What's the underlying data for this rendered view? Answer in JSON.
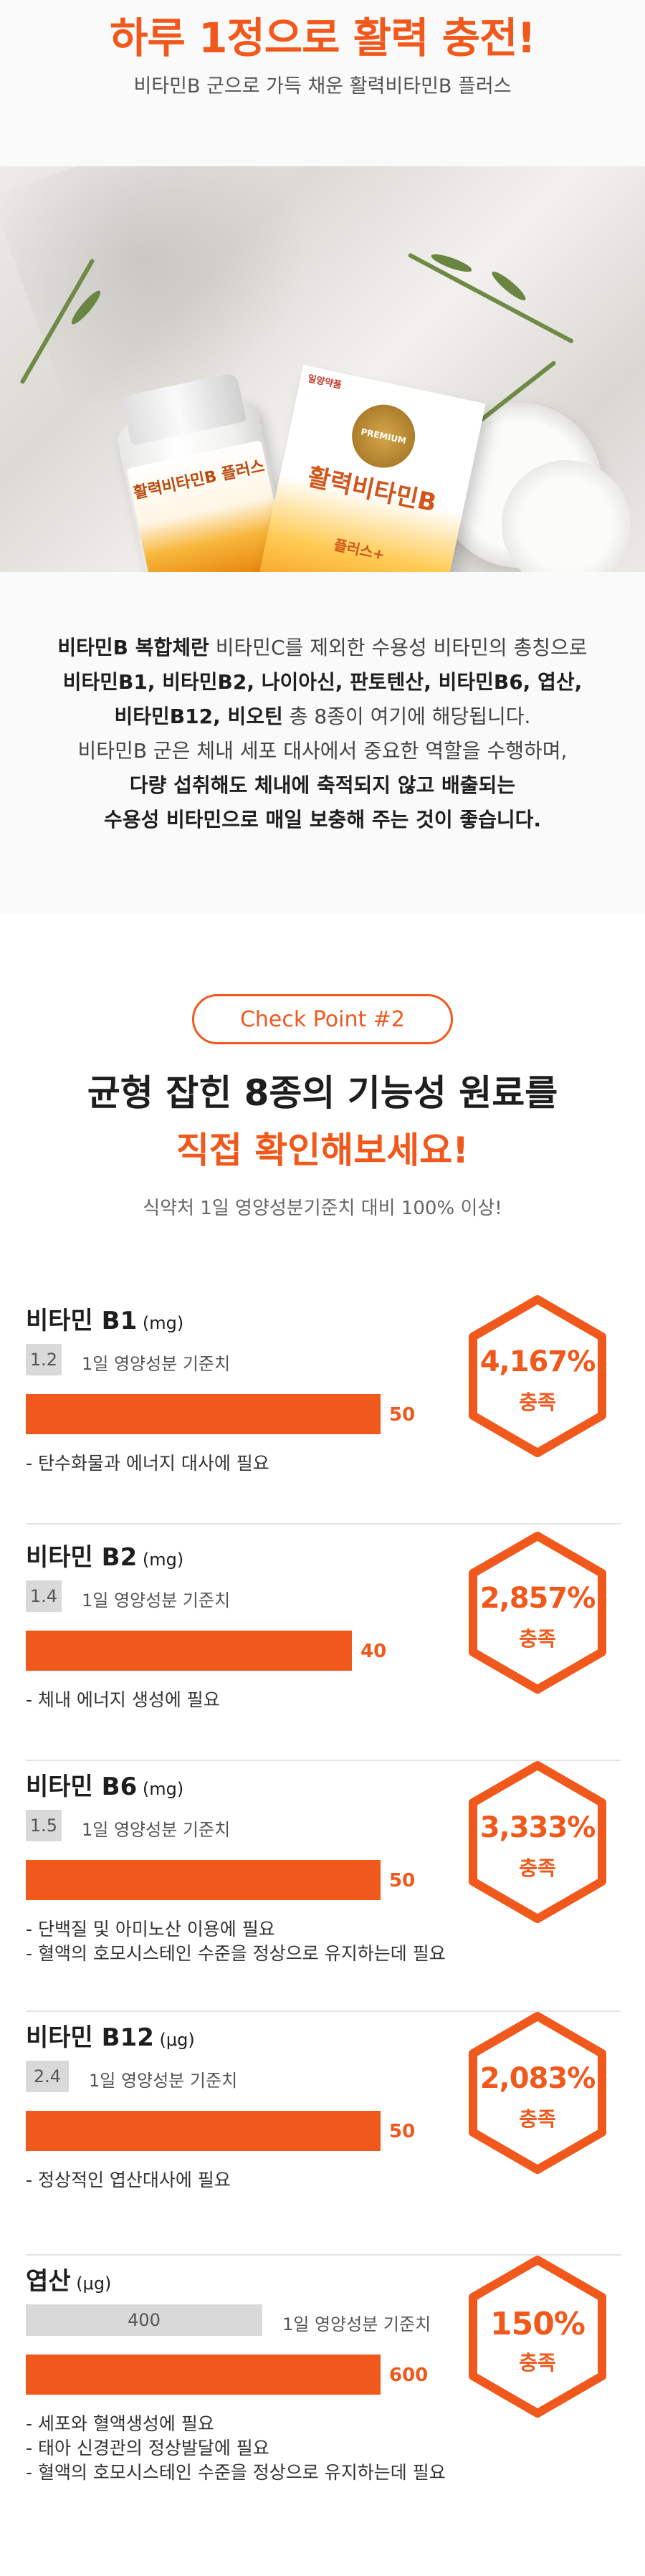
{
  "hero": {
    "title": "하루 1정으로 활력 충전!",
    "subtitle": "비타민B 군으로 가득 채운 활력비타민B 플러스"
  },
  "product": {
    "brand": "일양약품",
    "name_line1": "활력비타민B",
    "name_line2": "플러스+",
    "badge": "PREMIUM",
    "bottle_label": "활력비타민B 플러스"
  },
  "intro": {
    "line1_bold": "비타민B 복합체란",
    "line1_rest": " 비타민C를 제외한 수용성 비타민의 총칭으로",
    "line2_bold": "비타민B1, 비타민B2, 나이아신, 판토텐산, 비타민B6, 엽산,",
    "line3_bold": "비타민B12, 비오틴",
    "line3_rest": " 총 8종이 여기에 해당됩니다.",
    "line4": "비타민B 군은 체내 세포 대사에서 중요한 역할을 수행하며,",
    "line5_bold": "다량 섭취해도 체내에 축적되지 않고 배출되는",
    "line6_bold": "수용성 비타민으로 매일 보충해 주는 것이 좋습니다."
  },
  "check": {
    "pill": "Check Point #2",
    "heading1": "균형 잡힌 8종의 기능성 원료를",
    "heading2": "직접 확인해보세요!",
    "sub": "식약처 1일 영양성분기준치 대비 100% 이상!",
    "ref_label": "1일 영양성분 기준치",
    "achieve_word": "충족"
  },
  "nutrients": [
    {
      "name": "비타민 B1",
      "unit": "(mg)",
      "ref": "1.2",
      "amount": "50",
      "percent": "4,167%",
      "notes": [
        "- 탄수화물과 에너지 대사에 필요"
      ]
    },
    {
      "name": "비타민 B2",
      "unit": "(mg)",
      "ref": "1.4",
      "amount": "40",
      "percent": "2,857%",
      "notes": [
        "- 체내 에너지 생성에 필요"
      ]
    },
    {
      "name": "비타민 B6",
      "unit": "(mg)",
      "ref": "1.5",
      "amount": "50",
      "percent": "3,333%",
      "notes": [
        "- 단백질 및 아미노산 이용에 필요",
        "- 혈액의 호모시스테인 수준을 정상으로 유지하는데 필요"
      ]
    },
    {
      "name": "비타민 B12",
      "unit": "(μg)",
      "ref": "2.4",
      "amount": "50",
      "percent": "2,083%",
      "notes": [
        "- 정상적인 엽산대사에 필요"
      ]
    },
    {
      "name": "엽산",
      "unit": "(μg)",
      "ref": "400",
      "amount": "600",
      "percent": "150%",
      "notes": [
        "- 세포와 혈액생성에 필요",
        "- 태아 신경관의 정상발달에 필요",
        "- 혈액의 호모시스테인 수준을 정상으로 유지하는데 필요"
      ]
    }
  ],
  "colors": {
    "accent": "#f0581c",
    "ref_bar": "#d9d9d9"
  }
}
